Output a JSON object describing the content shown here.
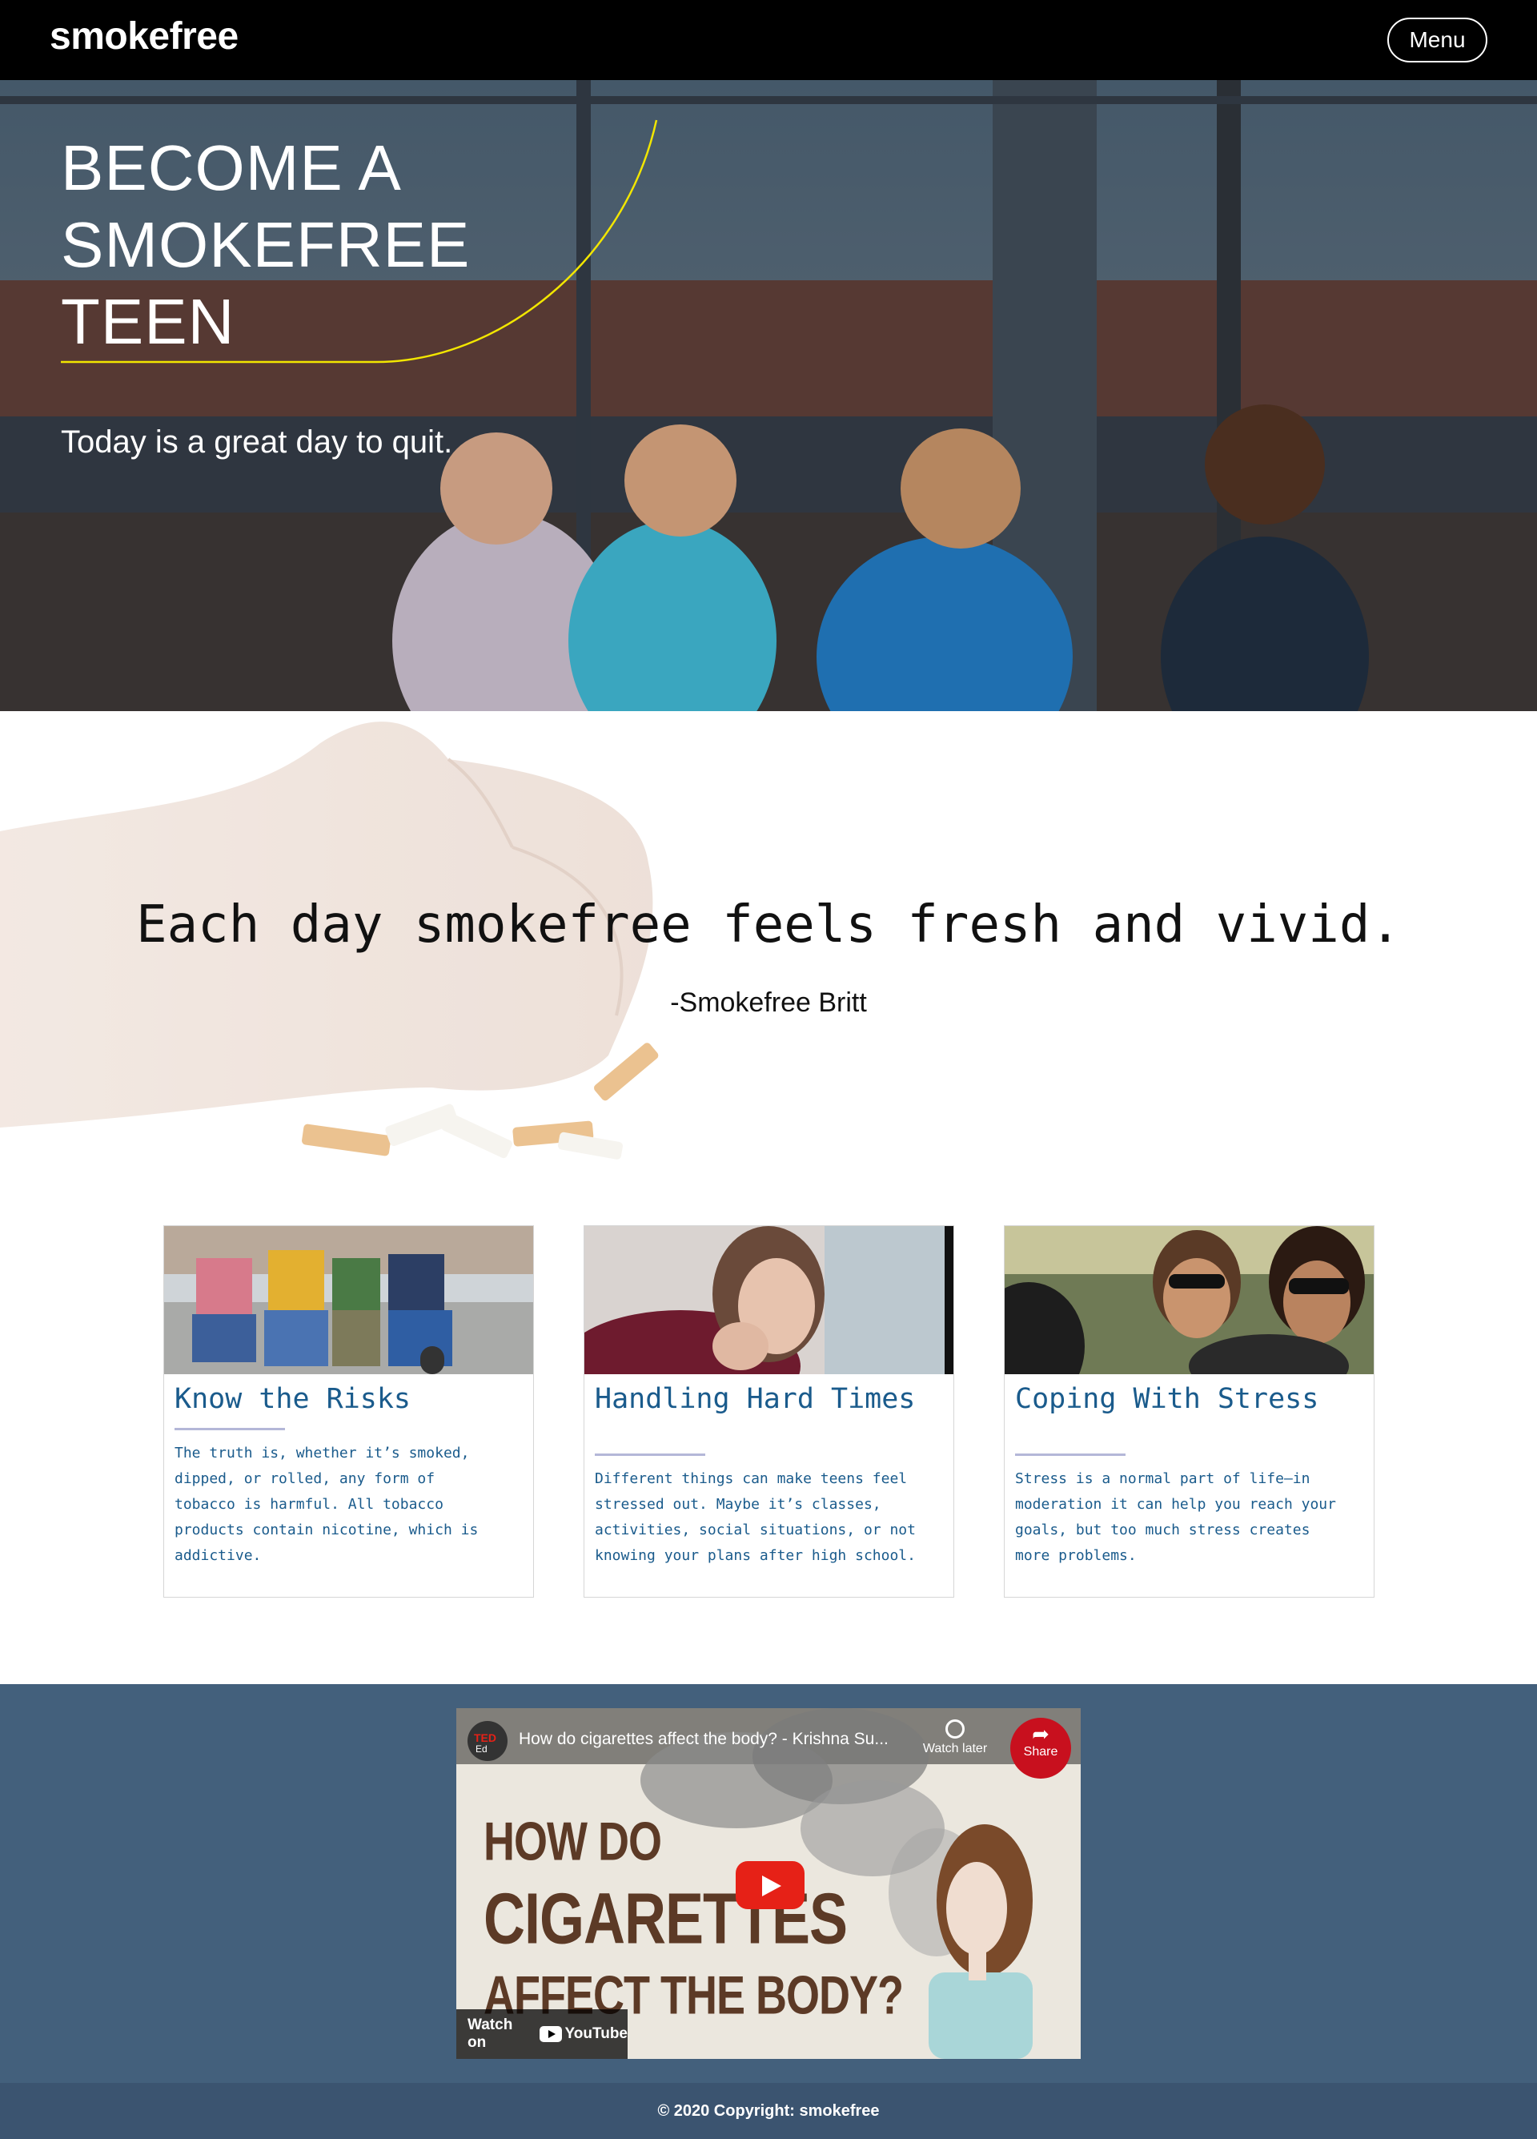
{
  "nav": {
    "brand": "smokefree",
    "menu_label": "Menu"
  },
  "hero": {
    "title_lines": [
      "BECOME A",
      "SMOKEFREE",
      "TEEN"
    ],
    "subtitle": "Today is a great day to quit.",
    "accent_color": "#f2e600"
  },
  "quote": {
    "text": "Each day smokefree feels fresh and vivid.",
    "author": "-Smokefree Britt"
  },
  "cards": [
    {
      "title": "Know the Risks",
      "lines": [
        "The truth is, whether it’s smoked,",
        "dipped, or rolled, any form of",
        "tobacco is harmful. All tobacco",
        "products contain nicotine, which is",
        "addictive."
      ]
    },
    {
      "title": "Handling Hard Times",
      "lines": [
        "Different things can make teens feel",
        "stressed out. Maybe it’s classes,",
        "activities, social situations, or not",
        "knowing your plans after high school."
      ]
    },
    {
      "title": "Coping With Stress",
      "lines": [
        "Stress is a normal part of life—in",
        "moderation it can help you reach your",
        "goals, but too much stress creates",
        "more problems."
      ]
    }
  ],
  "video": {
    "title": "How do cigarettes affect the body? - Krishna Su...",
    "channel_badge_top": "TED",
    "channel_badge_bottom": "Ed",
    "watch_later": "Watch later",
    "share": "Share",
    "share_badge": "TEDEd",
    "watch_on": "Watch on",
    "youtube": "YouTube",
    "heading_lines": [
      "HOW DO",
      "CIGARETTES",
      "AFFECT THE BODY?"
    ]
  },
  "footer": {
    "copyright": "© 2020 Copyright: smokefree"
  },
  "colors": {
    "card_text": "#1a5b8c",
    "card_rule": "#b4b7d8",
    "video_band": "#43607c",
    "footer": "#3b5470",
    "youtube_red": "#e62117"
  }
}
